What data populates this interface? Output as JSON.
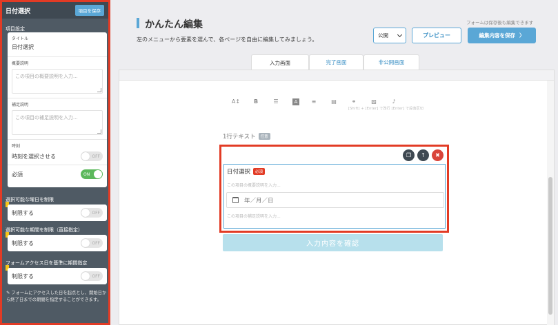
{
  "sidebar": {
    "title": "日付選択",
    "save_item_label": "項目を保存",
    "section_settings": "項目設定",
    "title_field": {
      "label": "タイトル",
      "value": "日付選択"
    },
    "summary_field": {
      "label": "概要説明",
      "placeholder": "この項目の概要説明を入力..."
    },
    "supplement_field": {
      "label": "補足説明",
      "placeholder": "この項目の補足説明を入力..."
    },
    "time": {
      "label": "時刻",
      "toggle_label": "時刻を選択させる",
      "state": "OFF"
    },
    "required": {
      "label": "必須",
      "state": "ON"
    },
    "weekday": {
      "section": "選択可能な曜日を制限",
      "toggle_label": "制限する",
      "state": "OFF"
    },
    "period": {
      "section": "選択可能な期間を制限（直接指定）",
      "toggle_label": "制限する",
      "state": "OFF"
    },
    "access_period": {
      "section": "フォームアクセス日を基準に期間指定",
      "toggle_label": "制限する",
      "state": "OFF"
    },
    "note": "フォームにアクセスした日を起点とし、開始日から終了日までの期間を指定することができます。"
  },
  "header": {
    "title": "かんたん編集",
    "subtitle": "左のメニューから要素を選んで、各ページを自由に編集してみましょう。",
    "save_note": "フォームは保存後も編集できます",
    "publish_select": "公開",
    "preview_label": "プレビュー",
    "save_label": "編集内容を保存",
    "save_arrow": "〉"
  },
  "tabs": [
    {
      "label": "入力画面",
      "active": true
    },
    {
      "label": "完了画面",
      "active": false
    },
    {
      "label": "非公開画面",
      "active": false
    }
  ],
  "toolbar": {
    "icons": [
      "text-size-icon",
      "bold-icon",
      "list-icon",
      "text-color-icon",
      "align-icon",
      "table-icon",
      "link-icon",
      "image-icon",
      "mic-icon"
    ],
    "glyphs": [
      "A↕",
      "B",
      "☰",
      "A",
      "≡",
      "▤",
      "⚭",
      "▨",
      "♪"
    ],
    "hint": "[Shift] + [Enter] で改行 [Enter] で段落区切"
  },
  "form": {
    "field1_label": "1行テキスト",
    "field1_badge": "任意",
    "date_title": "日付選択",
    "date_badge": "必須",
    "date_desc": "この項目の概要説明を入力...",
    "date_placeholder": "年／月／日",
    "date_note": "この項目の補足説明を入力...",
    "confirm_label": "入力内容を確認"
  },
  "colors": {
    "accent": "#5aa7d6",
    "highlight": "#e23b25",
    "sidebar": "#4f5a64",
    "on": "#5cb85c",
    "flag": "#f5c518"
  }
}
